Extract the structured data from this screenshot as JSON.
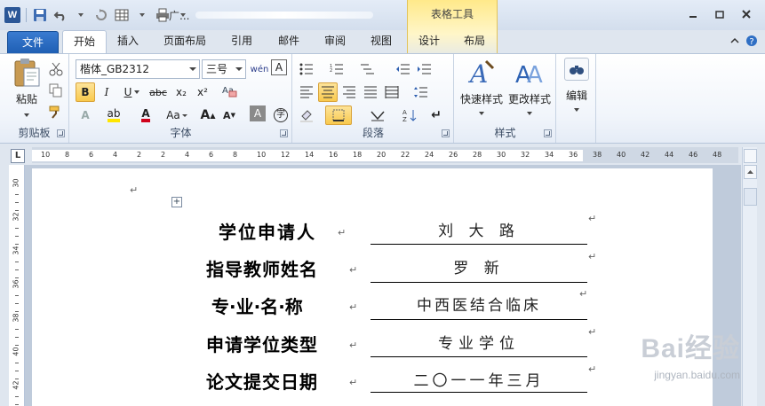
{
  "titlebar": {
    "app_icon": "W",
    "document_title": "广...",
    "context_tools_label": "表格工具"
  },
  "tabs": [
    {
      "label": "文件"
    },
    {
      "label": "开始"
    },
    {
      "label": "插入"
    },
    {
      "label": "页面布局"
    },
    {
      "label": "引用"
    },
    {
      "label": "邮件"
    },
    {
      "label": "审阅"
    },
    {
      "label": "视图"
    },
    {
      "label": "设计"
    },
    {
      "label": "布局"
    }
  ],
  "ribbon": {
    "clipboard": {
      "paste_label": "粘贴",
      "group_name": "剪贴板"
    },
    "font": {
      "font_name": "楷体_GB2312",
      "font_size": "三号",
      "group_name": "字体",
      "bold": "B",
      "italic": "I",
      "underline": "U",
      "strike": "abc",
      "subscript": "x₂",
      "superscript": "x²",
      "aa": "Aa",
      "grow": "A",
      "shrink": "A",
      "char_border": "A",
      "enclose": "字",
      "phonetic": "wén",
      "font_color": "A",
      "highlight": "ab"
    },
    "paragraph": {
      "group_name": "段落"
    },
    "styles": {
      "quick_label": "快速样式",
      "change_label": "更改样式",
      "group_name": "样式"
    },
    "editing": {
      "label": "编辑"
    }
  },
  "ruler": {
    "corner": "L",
    "h_ticks": [
      "10",
      "8",
      "6",
      "4",
      "2",
      "2",
      "4",
      "6",
      "8",
      "10",
      "12",
      "14",
      "16",
      "18",
      "20",
      "22",
      "24",
      "26",
      "28",
      "30",
      "32",
      "34",
      "36",
      "38",
      "40",
      "42",
      "44",
      "46",
      "48"
    ],
    "v_ticks": [
      "30",
      "32",
      "34",
      "36",
      "38",
      "40",
      "42"
    ]
  },
  "document": {
    "rows": [
      {
        "label": "学位申请人",
        "value": "刘 大 路"
      },
      {
        "label": "指导教师姓名",
        "value": "罗 新"
      },
      {
        "label": "专·业·名·称",
        "value": "中西医结合临床"
      },
      {
        "label": "申请学位类型",
        "value": "专业学位"
      },
      {
        "label": "论文提交日期",
        "value": "二〇一一年三月"
      }
    ],
    "para_mark": "↵"
  },
  "watermark": {
    "brand": "Bai经验",
    "url": "jingyan.baidu.com"
  }
}
